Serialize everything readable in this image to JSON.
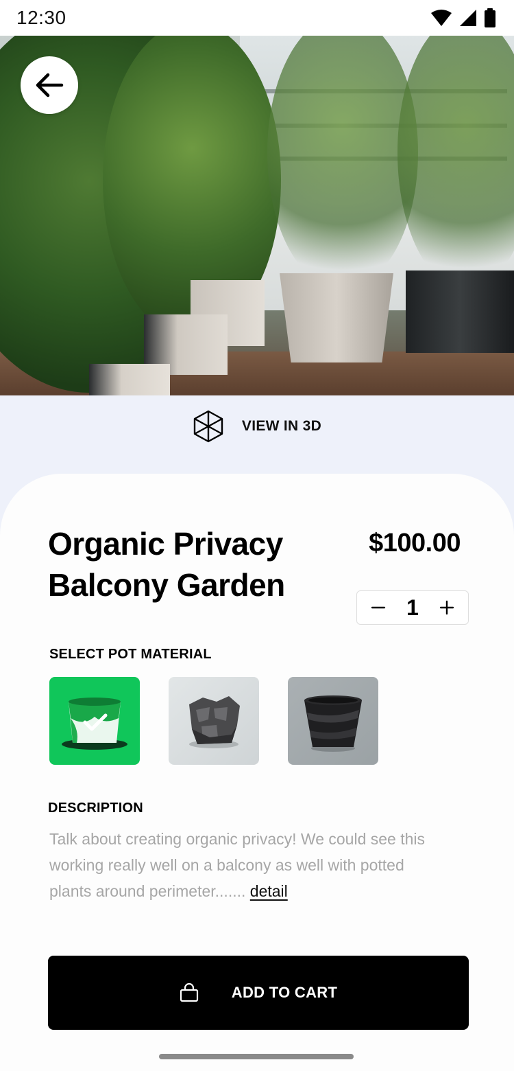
{
  "status_bar": {
    "time": "12:30",
    "icons": [
      "wifi-icon",
      "signal-icon",
      "battery-icon"
    ]
  },
  "hero": {
    "back_icon": "arrow-left-icon"
  },
  "view_3d": {
    "icon": "cube-3d-icon",
    "label": "VIEW IN 3D"
  },
  "product": {
    "title": "Organic Privacy Balcony Garden",
    "price": "$100.00",
    "quantity": "1",
    "decrement_icon": "minus-icon",
    "increment_icon": "plus-icon"
  },
  "materials": {
    "label": "SELECT POT MATERIAL",
    "selected_index": 0,
    "options": [
      {
        "icon": "green-ceramic-pot",
        "selected": true
      },
      {
        "icon": "stone-pot",
        "selected": false
      },
      {
        "icon": "dark-glazed-pot",
        "selected": false
      }
    ]
  },
  "description": {
    "label": "DESCRIPTION",
    "text": "Talk about creating organic privacy! We could see this working really well on a balcony as well with potted plants around perimeter.......",
    "link_label": "detail"
  },
  "cart": {
    "icon": "shopping-bag-icon",
    "label": "ADD TO CART"
  },
  "colors": {
    "page_background": "#eef1fa",
    "card_background": "#fdfdfd",
    "accent_green": "#10c65a",
    "button_background": "#000000",
    "description_text": "#a6a6a6"
  }
}
